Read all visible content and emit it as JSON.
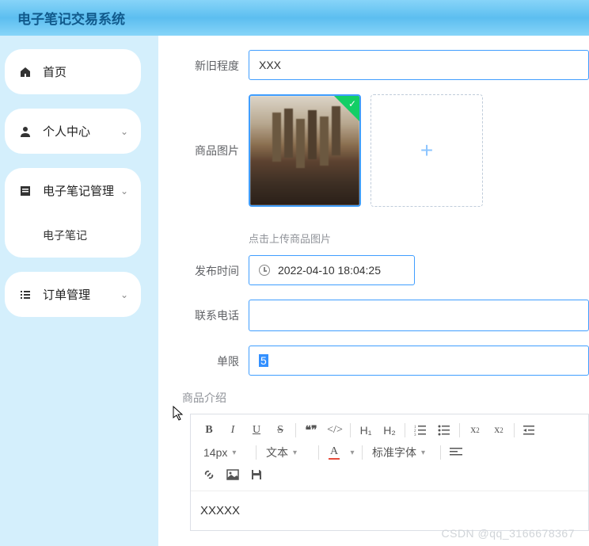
{
  "header": {
    "title": "电子笔记交易系统"
  },
  "sidebar": {
    "home": "首页",
    "personal": "个人中心",
    "notes_mgmt": "电子笔记管理",
    "notes_sub": "电子笔记",
    "orders": "订单管理"
  },
  "form": {
    "condition_label": "新旧程度",
    "condition_value": "XXX",
    "images_label": "商品图片",
    "upload_hint": "点击上传商品图片",
    "publish_label": "发布时间",
    "publish_value": "2022-04-10 18:04:25",
    "phone_label": "联系电话",
    "phone_value": "",
    "limit_label": "单限",
    "limit_value": "5",
    "desc_label": "商品介绍",
    "desc_value": "XXXXX"
  },
  "editor": {
    "font_size": "14px",
    "text_type": "文本",
    "font_family": "标准字体",
    "heading1": "H₁",
    "heading2": "H₂"
  },
  "watermark": "CSDN @qq_3166678367"
}
